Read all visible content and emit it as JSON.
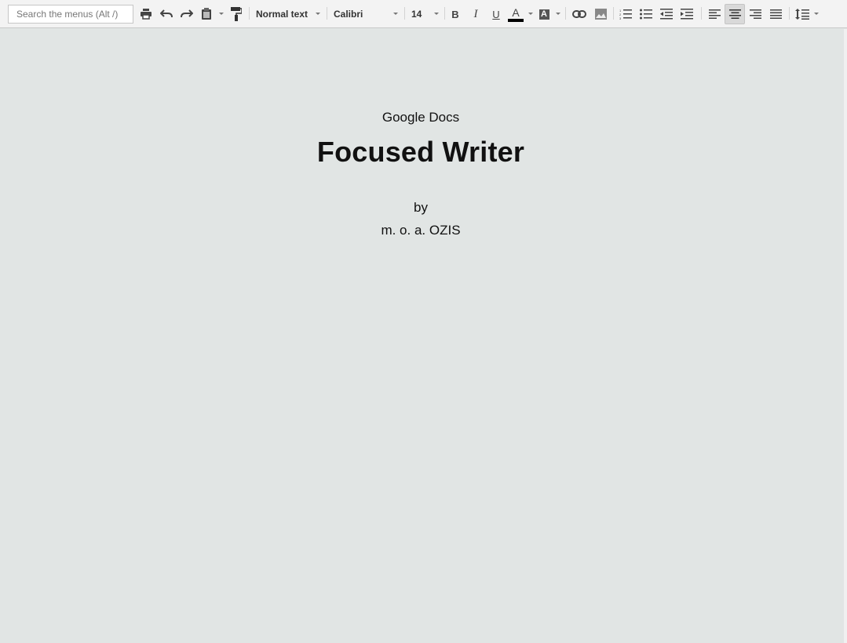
{
  "toolbar": {
    "search_placeholder": "Search the menus (Alt /)",
    "style_value": "Normal text",
    "font_value": "Calibri",
    "size_value": "14",
    "bold_label": "B",
    "italic_label": "I",
    "underline_label": "U",
    "text_color_label": "A",
    "highlight_label": "A",
    "text_color": "#000000",
    "active_alignment": "center"
  },
  "document": {
    "subtitle": "Google Docs",
    "title": "Focused Writer",
    "by_line": "by",
    "author": "m. o. a. OZIS"
  },
  "colors": {
    "toolbar_bg": "#f3f3f3",
    "page_bg": "#e1e5e4"
  }
}
